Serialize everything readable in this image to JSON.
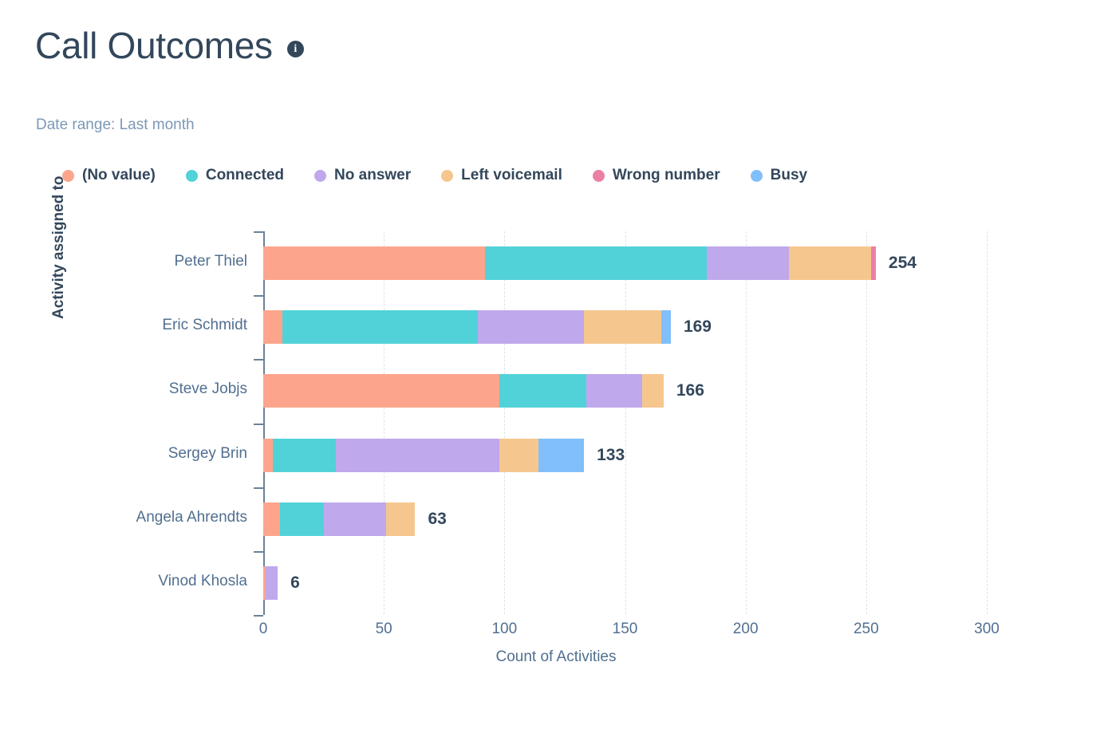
{
  "header": {
    "title": "Call Outcomes",
    "info_icon": "info-icon",
    "date_range": "Date range: Last month"
  },
  "chart_data": {
    "type": "bar",
    "orientation": "horizontal",
    "stacked": true,
    "title": "Call Outcomes",
    "subtitle": "Date range: Last month",
    "xlabel": "Count of Activities",
    "ylabel": "Activity assigned to",
    "xlim": [
      0,
      300
    ],
    "xticks": [
      "0",
      "50",
      "100",
      "150",
      "200",
      "250",
      "300"
    ],
    "grid": "vertical-dashed",
    "legend_position": "top-left",
    "categories": [
      "Peter Thiel",
      "Eric Schmidt",
      "Steve Jobjs",
      "Sergey Brin",
      "Angela Ahrendts",
      "Vinod Khosla"
    ],
    "totals": [
      254,
      169,
      166,
      133,
      63,
      6
    ],
    "series": [
      {
        "name": "(No value)",
        "color": "#FCA58C",
        "values": [
          92,
          8,
          98,
          4,
          7,
          1
        ]
      },
      {
        "name": "Connected",
        "color": "#51D2D8",
        "values": [
          92,
          81,
          36,
          26,
          18,
          0
        ]
      },
      {
        "name": "No answer",
        "color": "#BFA8EC",
        "values": [
          34,
          44,
          23,
          68,
          26,
          5
        ]
      },
      {
        "name": "Left voicemail",
        "color": "#F5C78E",
        "values": [
          34,
          32,
          9,
          16,
          12,
          0
        ]
      },
      {
        "name": "Wrong number",
        "color": "#EC7FA6",
        "values": [
          2,
          0,
          0,
          0,
          0,
          0
        ]
      },
      {
        "name": "Busy",
        "color": "#81BFFB",
        "values": [
          0,
          4,
          0,
          19,
          0,
          0
        ]
      }
    ],
    "legend": [
      {
        "label": "(No value)",
        "color": "#FCA58C"
      },
      {
        "label": "Connected",
        "color": "#51D2D8"
      },
      {
        "label": "No answer",
        "color": "#BFA8EC"
      },
      {
        "label": "Left voicemail",
        "color": "#F5C78E"
      },
      {
        "label": "Wrong number",
        "color": "#EC7FA6"
      },
      {
        "label": "Busy",
        "color": "#81BFFB"
      }
    ]
  }
}
